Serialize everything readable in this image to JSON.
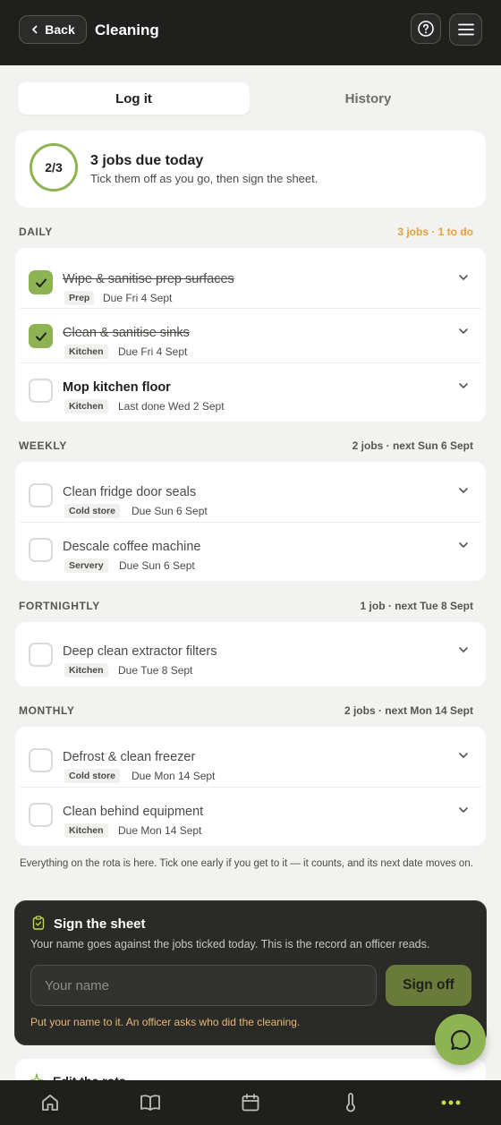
{
  "header": {
    "back_label": "Back",
    "title": "Cleaning",
    "icons": {
      "back": "chevron-left-icon",
      "help": "help-circle-icon",
      "menu": "hamburger-menu-icon"
    }
  },
  "tabs": {
    "log": "Log it",
    "history": "History",
    "active": "log"
  },
  "summary": {
    "progress": "2/3",
    "progress_value": {
      "done": 2,
      "total": 3
    },
    "title": "3 jobs due today",
    "subtitle": "Tick them off as you go, then sign the sheet."
  },
  "sections": {
    "daily": {
      "label": "DAILY",
      "meta": "3 jobs · 1 to do",
      "tasks": [
        {
          "title": "Wipe & sanitise prep surfaces",
          "tag": "Prep",
          "due": "Due Fri 4 Sept",
          "checked": true
        },
        {
          "title": "Clean & sanitise sinks",
          "tag": "Kitchen",
          "due": "Due Fri 4 Sept",
          "checked": true
        },
        {
          "title": "Mop kitchen floor",
          "tag": "Kitchen",
          "due": "Last done Wed 2 Sept",
          "checked": false
        }
      ]
    },
    "weekly": {
      "label": "WEEKLY",
      "meta": "2 jobs · next Sun 6 Sept",
      "tasks": [
        {
          "title": "Clean fridge door seals",
          "tag": "Cold store",
          "due": "Due Sun 6 Sept",
          "checked": false
        },
        {
          "title": "Descale coffee machine",
          "tag": "Servery",
          "due": "Due Sun 6 Sept",
          "checked": false
        }
      ]
    },
    "fortnightly": {
      "label": "FORTNIGHTLY",
      "meta": "1 job · next Tue 8 Sept",
      "tasks": [
        {
          "title": "Deep clean extractor filters",
          "tag": "Kitchen",
          "due": "Due Tue 8 Sept",
          "checked": false
        }
      ]
    },
    "monthly": {
      "label": "MONTHLY",
      "meta": "2 jobs · next Mon 14 Sept",
      "tasks": [
        {
          "title": "Defrost & clean freezer",
          "tag": "Cold store",
          "due": "Due Mon 14 Sept",
          "checked": false
        },
        {
          "title": "Clean behind equipment",
          "tag": "Kitchen",
          "due": "Due Mon 14 Sept",
          "checked": false
        }
      ]
    }
  },
  "footnote": "Everything on the rota is here. Tick one early if you get to it — it counts, and its next date moves on.",
  "sign": {
    "title": "Sign the sheet",
    "subtitle": "Your name goes against the jobs ticked today. This is the record an officer reads.",
    "placeholder": "Your name",
    "value": "",
    "button": "Sign off",
    "warning": "Put your name to it. An officer asks who did the cleaning.",
    "icon": "clipboard-check-icon"
  },
  "edit_rota": {
    "title": "Edit the rota",
    "icon": "sparkle-icon"
  },
  "chat": {
    "icon": "chat-bubble-icon"
  },
  "bottom_nav": [
    "home-icon",
    "book-icon",
    "calendar-icon",
    "thermometer-icon",
    "more-dots-icon"
  ],
  "colors": {
    "accent": "#8db352",
    "dark": "#1f1f1d",
    "warn": "#e3a03c",
    "background": "#f2f2f0"
  }
}
